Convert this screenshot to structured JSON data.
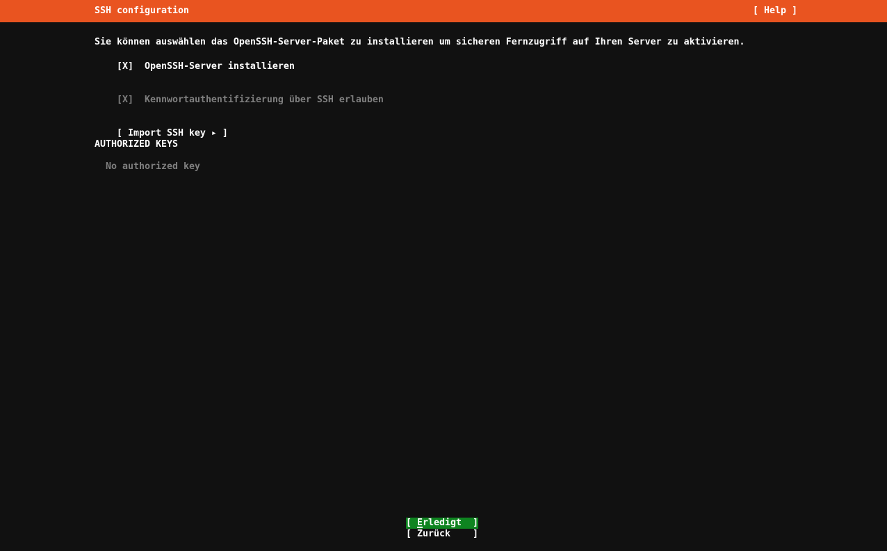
{
  "header": {
    "title": "SSH configuration",
    "help_label": "[ Help ]"
  },
  "intro": "Sie können auswählen das OpenSSH-Server-Paket zu installieren um sicheren Fernzugriff auf Ihren Server zu aktivieren.",
  "options": {
    "install_server": {
      "box": "[X]",
      "label": "OpenSSH-Server installieren",
      "checked": true,
      "enabled": true
    },
    "password_auth": {
      "box": "[X]",
      "label": "Kennwortauthentifizierung über SSH erlauben",
      "checked": true,
      "enabled": false
    }
  },
  "import_button": {
    "label": "[ Import SSH key ▸ ]"
  },
  "authorized_keys": {
    "heading": "AUTHORIZED KEYS",
    "empty_message": "No authorized key"
  },
  "footer": {
    "done_button": {
      "label": "[ Erledigt  ]",
      "focused": true
    },
    "back_button": {
      "label": "[ Zurück    ]"
    }
  },
  "colors": {
    "header_orange": "#e95420",
    "focus_green": "#0e8420",
    "background": "#111111",
    "text": "#ffffff",
    "dim_text": "#7f7f7f"
  }
}
